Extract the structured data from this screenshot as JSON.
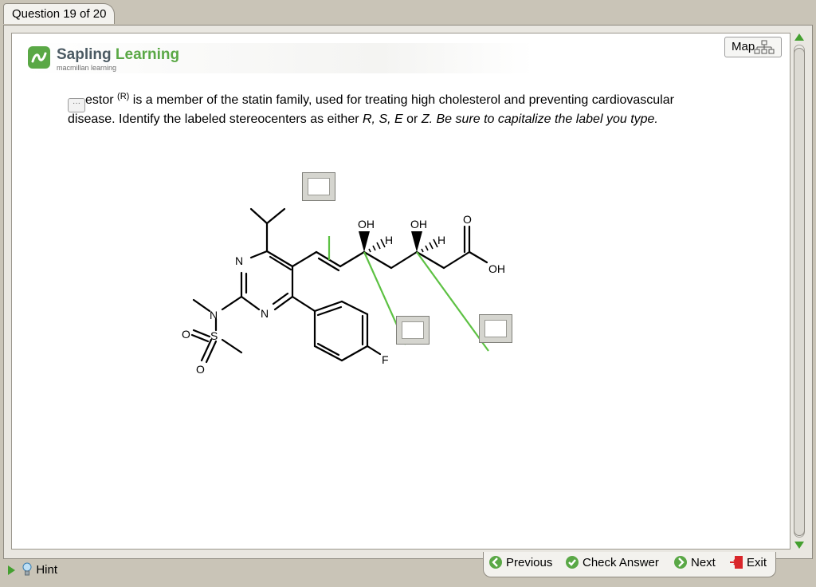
{
  "tab": {
    "label": "Question 19 of 20"
  },
  "branding": {
    "name_part1": "Sapling",
    "name_part2": "Learning",
    "subtitle": "macmillan learning"
  },
  "map": {
    "label": "Map"
  },
  "question": {
    "line1_pre": "estor",
    "line1_sup": "(R)",
    "line1_post": " is a member of the statin family, used for treating high cholesterol and preventing cardiovascular",
    "line2_pre": "disease. Identify the labeled stereocenters as either ",
    "line2_options": "R, S, E",
    "line2_or": " or ",
    "line2_z": "Z",
    "line2_italic": ". Be sure to capitalize the label you type."
  },
  "molecule": {
    "atoms": {
      "n1": "N",
      "n2": "N",
      "n3": "N",
      "s": "S",
      "o1": "O",
      "o2": "O",
      "f": "F",
      "oh1": "OH",
      "oh2": "OH",
      "oh3": "OH",
      "h1": "H",
      "h2": "H",
      "o_acid": "O"
    }
  },
  "answers": {
    "box1": "",
    "box2": "",
    "box3": ""
  },
  "hint": {
    "label": "Hint"
  },
  "nav": {
    "previous": "Previous",
    "check": "Check Answer",
    "next": "Next",
    "exit": "Exit"
  },
  "colors": {
    "accent_green": "#5aa846",
    "leader_line": "#5dc143",
    "exit_red": "#d9262a"
  }
}
